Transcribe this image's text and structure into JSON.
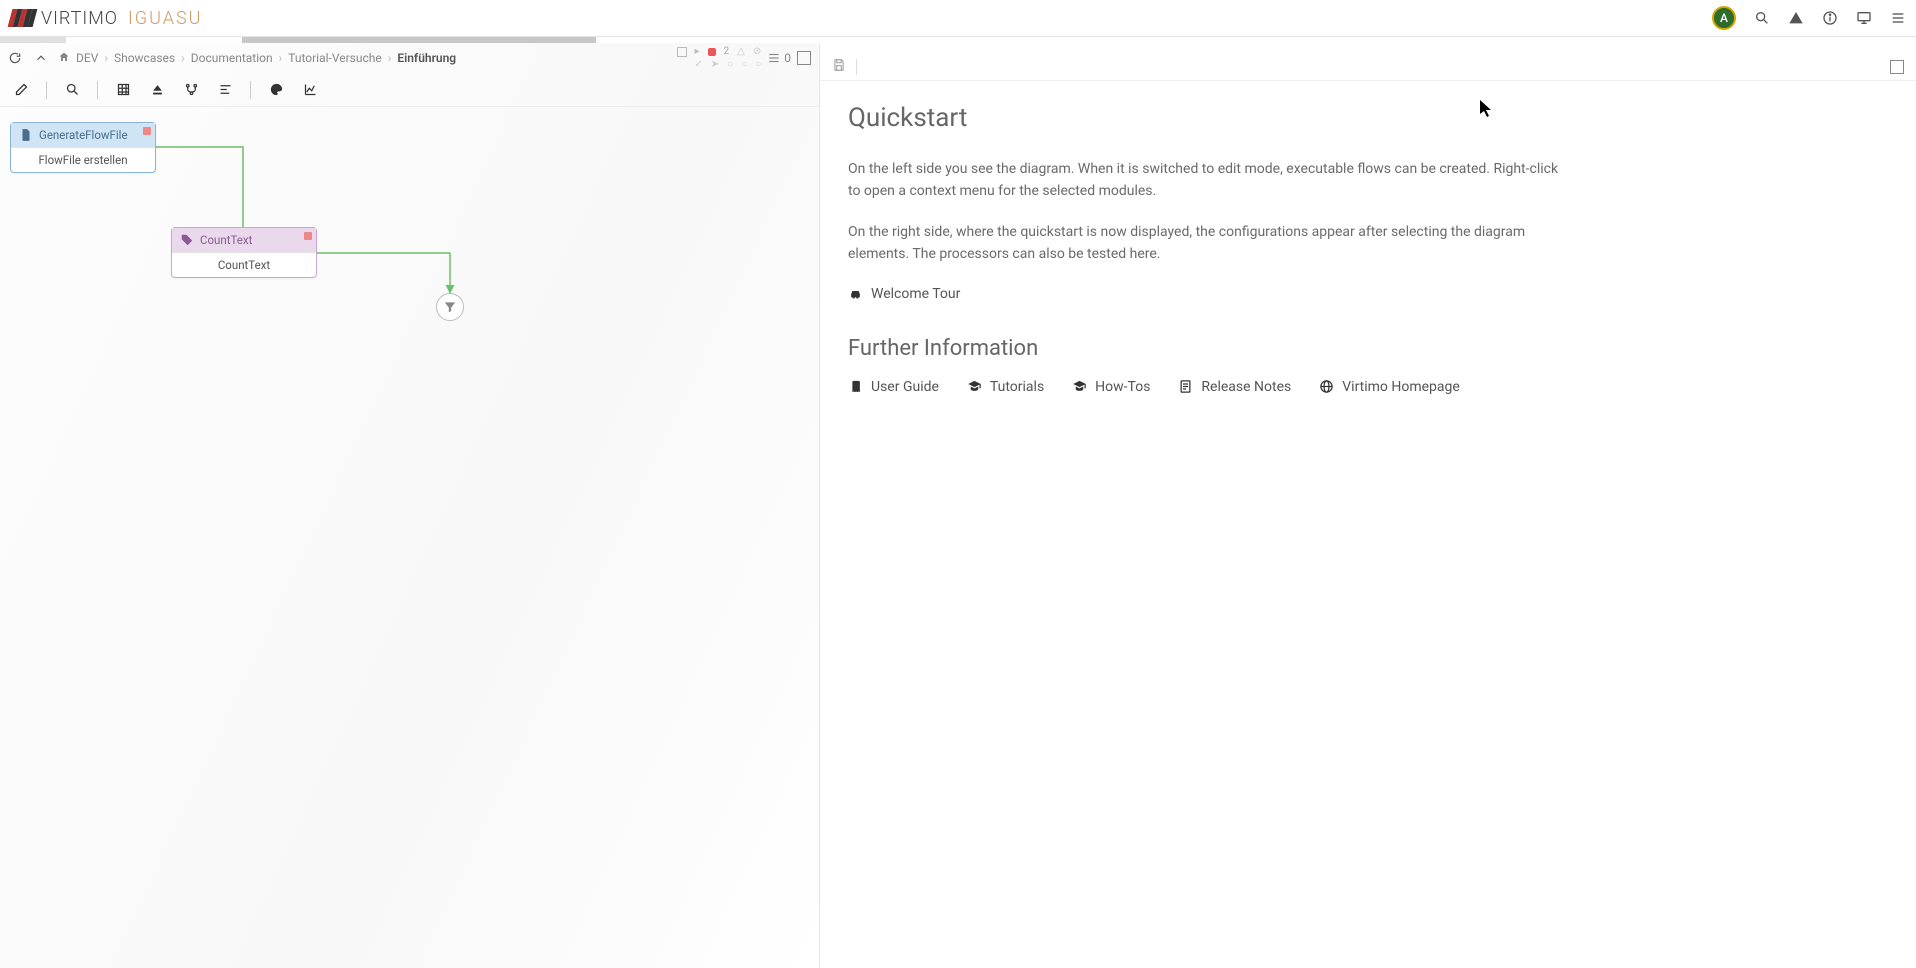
{
  "app": {
    "brand": "VIRTIMO",
    "product": "IGUASU"
  },
  "header": {
    "avatar_initial": "A"
  },
  "breadcrumb": {
    "root": "DEV",
    "items": [
      "Showcases",
      "Documentation",
      "Tutorial-Versuche"
    ],
    "current": "Einführung"
  },
  "status": {
    "stopped_count": "2",
    "list_count": "0"
  },
  "nodes": {
    "n1": {
      "type": "GenerateFlowFile",
      "label": "FlowFile erstellen"
    },
    "n2": {
      "type": "CountText",
      "label": "CountText"
    }
  },
  "panel": {
    "title": "Quickstart",
    "p1": "On the left side you see the diagram. When it is switched to edit mode, executable flows can be created. Right-click to open a context menu for the selected modules.",
    "p2": "On the right side, where the quickstart is now displayed, the configurations appear after selecting the diagram elements. The processors can also be tested here.",
    "welcome_link": "Welcome Tour",
    "section2": "Further Information",
    "links": {
      "guide": "User Guide",
      "tutorials": "Tutorials",
      "howtos": "How-Tos",
      "release": "Release Notes",
      "home": "Virtimo Homepage"
    }
  }
}
